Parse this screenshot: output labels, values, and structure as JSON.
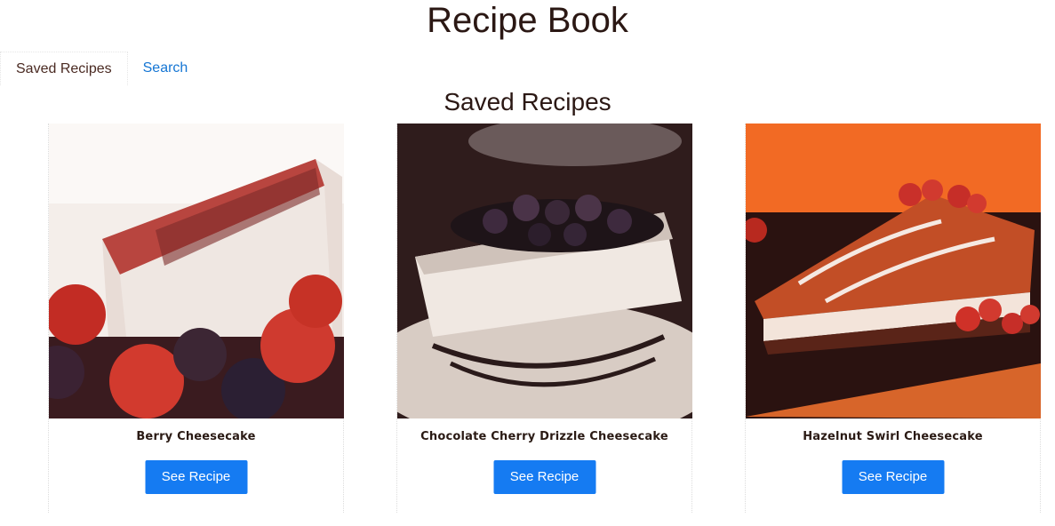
{
  "app": {
    "title": "Recipe Book"
  },
  "nav": {
    "tabs": [
      {
        "label": "Saved Recipes",
        "active": true
      },
      {
        "label": "Search",
        "active": false
      }
    ]
  },
  "main": {
    "section_title": "Saved Recipes",
    "recipes": [
      {
        "name": "Berry Cheesecake",
        "button_label": "See Recipe",
        "image": "berry-cheesecake-photo"
      },
      {
        "name": "Chocolate Cherry Drizzle Cheesecake",
        "button_label": "See Recipe",
        "image": "chocolate-cherry-cheesecake-photo"
      },
      {
        "name": "Hazelnut Swirl Cheesecake",
        "button_label": "See Recipe",
        "image": "hazelnut-swirl-cheesecake-photo"
      }
    ]
  },
  "colors": {
    "accent": "#157bf2",
    "link": "#1576d4",
    "heading": "#2b1814"
  }
}
